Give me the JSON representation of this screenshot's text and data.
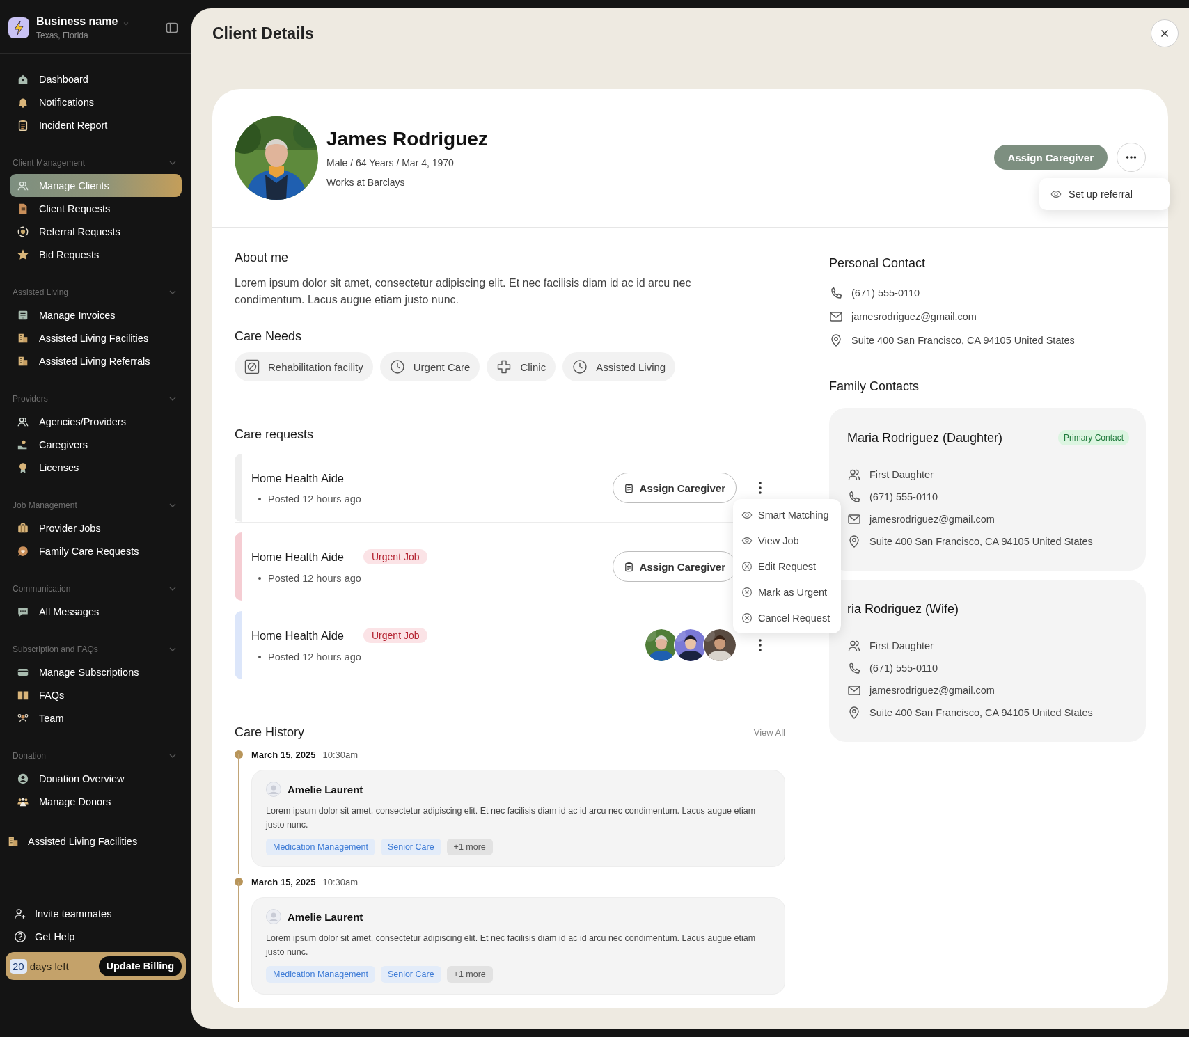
{
  "sidebar": {
    "business": {
      "name": "Business name",
      "location": "Texas, Florida"
    },
    "top_items": [
      {
        "label": "Dashboard",
        "selected": false
      },
      {
        "label": "Notifications",
        "selected": false
      },
      {
        "label": "Incident Report",
        "selected": false
      }
    ],
    "sections": [
      {
        "title": "Client Management",
        "expanded": true,
        "items": [
          {
            "label": "Manage Clients",
            "selected": true
          },
          {
            "label": "Client Requests",
            "selected": false
          },
          {
            "label": "Referral Requests",
            "selected": false
          },
          {
            "label": "Bid Requests",
            "selected": false
          }
        ]
      },
      {
        "title": "Assisted Living",
        "expanded": true,
        "items": [
          {
            "label": "Manage Invoices",
            "selected": false
          },
          {
            "label": "Assisted Living Facilities",
            "selected": false
          },
          {
            "label": "Assisted Living Referrals",
            "selected": false
          }
        ]
      },
      {
        "title": "Providers",
        "expanded": true,
        "items": [
          {
            "label": "Agencies/Providers",
            "selected": false
          },
          {
            "label": "Caregivers",
            "selected": false
          },
          {
            "label": "Licenses",
            "selected": false
          }
        ]
      },
      {
        "title": "Job Management",
        "expanded": true,
        "items": [
          {
            "label": "Provider Jobs",
            "selected": false
          },
          {
            "label": "Family Care Requests",
            "selected": false
          }
        ]
      },
      {
        "title": "Communication",
        "expanded": true,
        "items": [
          {
            "label": "All Messages",
            "selected": false
          }
        ]
      },
      {
        "title": "Subscription and FAQs",
        "expanded": true,
        "items": [
          {
            "label": "Manage Subscriptions",
            "selected": false
          },
          {
            "label": "FAQs",
            "selected": false
          },
          {
            "label": "Team",
            "selected": false
          }
        ]
      },
      {
        "title": "Donation",
        "expanded": true,
        "items": [
          {
            "label": "Donation Overview",
            "selected": false
          },
          {
            "label": "Manage Donors",
            "selected": false
          }
        ]
      }
    ],
    "extra_items": [
      {
        "label": "Assisted Living Facilities",
        "selected": false
      }
    ],
    "footer_links": [
      {
        "label": "Invite teammates"
      },
      {
        "label": "Get Help"
      }
    ],
    "billing": {
      "days": "20",
      "days_label": "days left",
      "button": "Update Billing"
    }
  },
  "page": {
    "title": "Client Details"
  },
  "client": {
    "name": "James Rodriguez",
    "details": "Male / 64 Years / Mar 4, 1970",
    "work": "Works at Barclays",
    "assign_button": "Assign Caregiver",
    "menu": [
      {
        "label": "Set up referral",
        "kind": "view"
      }
    ]
  },
  "about": {
    "heading": "About me",
    "text": "Lorem ipsum dolor sit amet, consectetur adipiscing elit. Et nec facilisis diam id ac id arcu nec condimentum. Lacus augue etiam justo nunc."
  },
  "care_needs": {
    "heading": "Care Needs",
    "items": [
      {
        "label": "Rehabilitation facility",
        "kind": "rehab"
      },
      {
        "label": "Urgent Care",
        "kind": "hours"
      },
      {
        "label": "Clinic",
        "kind": "clinic"
      },
      {
        "label": "Assisted Living",
        "kind": "hours"
      }
    ]
  },
  "care_requests": {
    "heading": "Care requests",
    "rows": [
      {
        "title": "Home Health Aide",
        "posted": "Posted 12 hours ago",
        "color": "#eeeeee",
        "kind": "assign",
        "button": "Assign Caregiver",
        "more_button": true,
        "menu": [
          {
            "label": "Smart Matching",
            "kind": "view"
          },
          {
            "label": "View Job",
            "kind": "view"
          },
          {
            "label": "Edit Request",
            "kind": "action"
          },
          {
            "label": "Mark as Urgent",
            "kind": "action"
          },
          {
            "label": "Cancel Request",
            "kind": "action"
          }
        ]
      },
      {
        "title": "Home Health Aide",
        "badge": "Urgent Job",
        "posted": "Posted 12 hours ago",
        "color": "#f5cdd3",
        "kind": "assign",
        "button": "Assign Caregiver",
        "more_button": false
      },
      {
        "title": "Home Health Aide",
        "badge": "Urgent Job",
        "posted": "Posted 12 hours ago",
        "color": "#dce6fa",
        "kind": "caregivers",
        "more_button": true
      }
    ]
  },
  "care_history": {
    "heading": "Care History",
    "view_all": "View All",
    "entries": [
      {
        "date": "March 15, 2025",
        "time": "10:30am",
        "author": "Amelie Laurent",
        "text": "Lorem ipsum dolor sit amet, consectetur adipiscing elit. Et nec facilisis diam id ac id arcu nec condimentum. Lacus augue etiam justo nunc.",
        "tags": [
          {
            "label": "Medication Management",
            "kind": "tag"
          },
          {
            "label": "Senior Care",
            "kind": "tag"
          },
          {
            "label": "+1 more",
            "kind": "more"
          }
        ]
      },
      {
        "date": "March 15, 2025",
        "time": "10:30am",
        "author": "Amelie Laurent",
        "text": "Lorem ipsum dolor sit amet, consectetur adipiscing elit. Et nec facilisis diam id ac id arcu nec condimentum. Lacus augue etiam justo nunc.",
        "tags": [
          {
            "label": "Medication Management",
            "kind": "tag"
          },
          {
            "label": "Senior Care",
            "kind": "tag"
          },
          {
            "label": "+1 more",
            "kind": "more"
          }
        ]
      }
    ]
  },
  "personal_contact": {
    "heading": "Personal Contact",
    "rows": [
      {
        "kind": "phone",
        "text": "(671) 555-0110"
      },
      {
        "kind": "email",
        "text": "jamesrodriguez@gmail.com"
      },
      {
        "kind": "address",
        "text": "Suite 400 San Francisco, CA 94105 United States"
      }
    ]
  },
  "family_contacts": {
    "heading": "Family Contacts",
    "cards": [
      {
        "name": "Maria Rodriguez (Daughter)",
        "badge": "Primary Contact",
        "rows": [
          {
            "kind": "relation",
            "text": "First Daughter"
          },
          {
            "kind": "phone",
            "text": "(671) 555-0110"
          },
          {
            "kind": "email",
            "text": "jamesrodriguez@gmail.com"
          },
          {
            "kind": "address",
            "text": "Suite 400 San Francisco, CA 94105 United States"
          }
        ]
      },
      {
        "name": "ria Rodriguez (Wife)",
        "rows": [
          {
            "kind": "relation",
            "text": "First Daughter"
          },
          {
            "kind": "phone",
            "text": "(671) 555-0110"
          },
          {
            "kind": "email",
            "text": "jamesrodriguez@gmail.com"
          },
          {
            "kind": "address",
            "text": "Suite 400 San Francisco, CA 94105 United States"
          }
        ]
      }
    ]
  }
}
